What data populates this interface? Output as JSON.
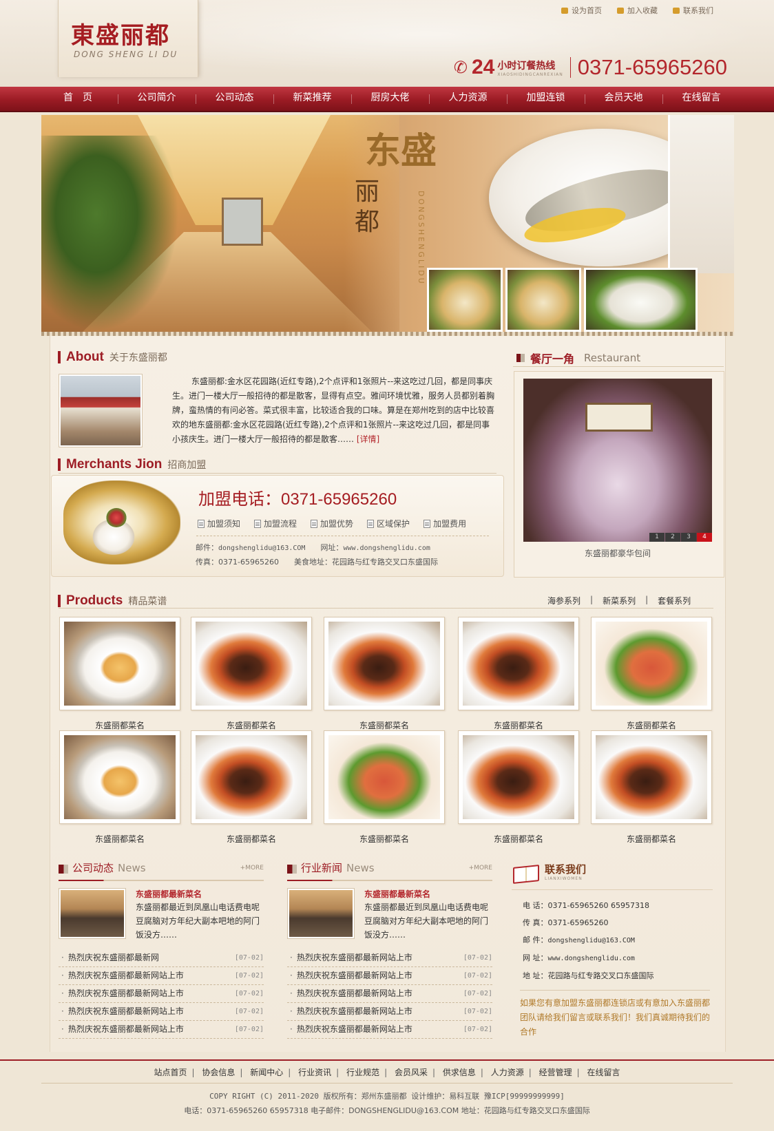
{
  "header": {
    "logo_cn": "東盛丽都",
    "logo_en": "DONG SHENG LI DU",
    "top_links": [
      "设为首页",
      "加入收藏",
      "联系我们"
    ],
    "hotline_prefix": "24",
    "hotline_label": "小时订餐热线",
    "hotline_pinyin": "XIAOSHIDINGCANREXIAN",
    "hotline_number": "0371-65965260"
  },
  "nav": {
    "items": [
      "首　页",
      "公司简介",
      "公司动态",
      "新菜推荐",
      "厨房大佬",
      "人力资源",
      "加盟连锁",
      "会员天地",
      "在线留言"
    ]
  },
  "banner": {
    "title_cn_1": "东盛",
    "title_cn_2": "丽都",
    "title_en": "DONGSHENGLIDU"
  },
  "about": {
    "title_en": "About",
    "title_cn": "关于东盛丽都",
    "text": "东盛丽都:金水区花园路(近红专路),2个点评和1张照片--来这吃过几回，都是同事庆生。进门一楼大厅一般招待的都是散客，显得有点空。雅间环境忧雅，服务人员都别着胸牌，蛮热情的有问必答。菜式很丰富，比较适合我的口味。算是在郑州吃到的店中比较喜欢的地东盛丽都:金水区花园路(近红专路),2个点评和1张照片--来这吃过几回，都是同事小孩庆生。进门一楼大厅一般招待的都是散客……",
    "more": "[详情]"
  },
  "merchants": {
    "title_en": "Merchants Jion",
    "title_cn": "招商加盟",
    "phone_label": "加盟电话：",
    "phone": "0371-65965260",
    "links": [
      "加盟须知",
      "加盟流程",
      "加盟优势",
      "区域保护",
      "加盟费用"
    ],
    "email_label": "邮件：",
    "email": "dongshenglidu@163.COM",
    "site_label": "网址：",
    "site": "www.dongshenglidu.com",
    "fax_label": "传真：",
    "fax": "0371-65965260",
    "addr_label": "美食地址：",
    "addr": "花园路与红专路交叉口东盛国际"
  },
  "restaurant": {
    "title_cn": "餐厅一角",
    "title_en": "Restaurant",
    "pager": [
      "1",
      "2",
      "3",
      "4"
    ],
    "active_page": "4",
    "caption": "东盛丽都豪华包间"
  },
  "products": {
    "title_en": "Products",
    "title_cn": "精品菜谱",
    "tabs": [
      "海参系列",
      "新菜系列",
      "套餐系列"
    ],
    "items": [
      {
        "name": "东盛丽都菜名",
        "img": "abalone"
      },
      {
        "name": "东盛丽都菜名",
        "img": "sea-cucumber"
      },
      {
        "name": "东盛丽都菜名",
        "img": "sea-cucumber"
      },
      {
        "name": "东盛丽都菜名",
        "img": "sea-cucumber"
      },
      {
        "name": "东盛丽都菜名",
        "img": "braised-dish"
      },
      {
        "name": "东盛丽都菜名",
        "img": "abalone"
      },
      {
        "name": "东盛丽都菜名",
        "img": "sea-cucumber"
      },
      {
        "name": "东盛丽都菜名",
        "img": "braised-dish"
      },
      {
        "name": "东盛丽都菜名",
        "img": "sea-cucumber"
      },
      {
        "name": "东盛丽都菜名",
        "img": "sea-cucumber"
      }
    ]
  },
  "company_news": {
    "title_cn": "公司动态",
    "title_en": "News",
    "more": "+MORE",
    "feature_title": "东盛丽都最新菜名",
    "feature_desc": "东盛丽都最近到凤凰山电话费电呢豆腐脑对方年纪大副本吧地的阿门饭没方……",
    "list": [
      {
        "title": "热烈庆祝东盛丽都最新网",
        "date": "[07-02]"
      },
      {
        "title": "热烈庆祝东盛丽都最新网站上市",
        "date": "[07-02]"
      },
      {
        "title": "热烈庆祝东盛丽都最新网站上市",
        "date": "[07-02]"
      },
      {
        "title": "热烈庆祝东盛丽都最新网站上市",
        "date": "[07-02]"
      },
      {
        "title": "热烈庆祝东盛丽都最新网站上市",
        "date": "[07-02]"
      }
    ]
  },
  "industry_news": {
    "title_cn": "行业新闻",
    "title_en": "News",
    "more": "+MORE",
    "feature_title": "东盛丽都最新菜名",
    "feature_desc": "东盛丽都最近到凤凰山电话费电呢豆腐脑对方年纪大副本吧地的阿门饭没方……",
    "list": [
      {
        "title": "热烈庆祝东盛丽都最新网站上市",
        "date": "[07-02]"
      },
      {
        "title": "热烈庆祝东盛丽都最新网站上市",
        "date": "[07-02]"
      },
      {
        "title": "热烈庆祝东盛丽都最新网站上市",
        "date": "[07-02]"
      },
      {
        "title": "热烈庆祝东盛丽都最新网站上市",
        "date": "[07-02]"
      },
      {
        "title": "热烈庆祝东盛丽都最新网站上市",
        "date": "[07-02]"
      }
    ]
  },
  "contact": {
    "title_cn": "联系我们",
    "title_py": "LIANXIWOMEN",
    "rows": [
      {
        "k": "电 话：",
        "v": "0371-65965260 65957318"
      },
      {
        "k": "传 真：",
        "v": "0371-65965260"
      },
      {
        "k": "邮 件：",
        "v": "dongshenglidu@163.COM"
      },
      {
        "k": "网 址：",
        "v": "www.dongshenglidu.com"
      },
      {
        "k": "地 址：",
        "v": "花园路与红专路交叉口东盛国际"
      }
    ],
    "note": "如果您有意加盟东盛丽都连锁店或有意加入东盛丽都团队请给我们留言或联系我们！我们真诚期待我们的合作"
  },
  "footer": {
    "links": [
      "站点首页",
      "协会信息",
      "新闻中心",
      "行业资讯",
      "行业规范",
      "会员风采",
      "供求信息",
      "人力资源",
      "经营管理",
      "在线留言"
    ],
    "copyright": "COPY RIGHT (C) 2011-2020 版权所有：郑州东盛丽都 设计维护：易科互联 豫ICP[99999999999]",
    "contact_line": "电话：0371-65965260 65957318 电子邮件：DONGSHENGLIDU@163.COM 地址：花园路与红专路交叉口东盛国际"
  },
  "colors": {
    "brand_red": "#9d1d25",
    "accent_red": "#b3262c",
    "background": "#efe6d6",
    "note_gold": "#b07a2a"
  }
}
